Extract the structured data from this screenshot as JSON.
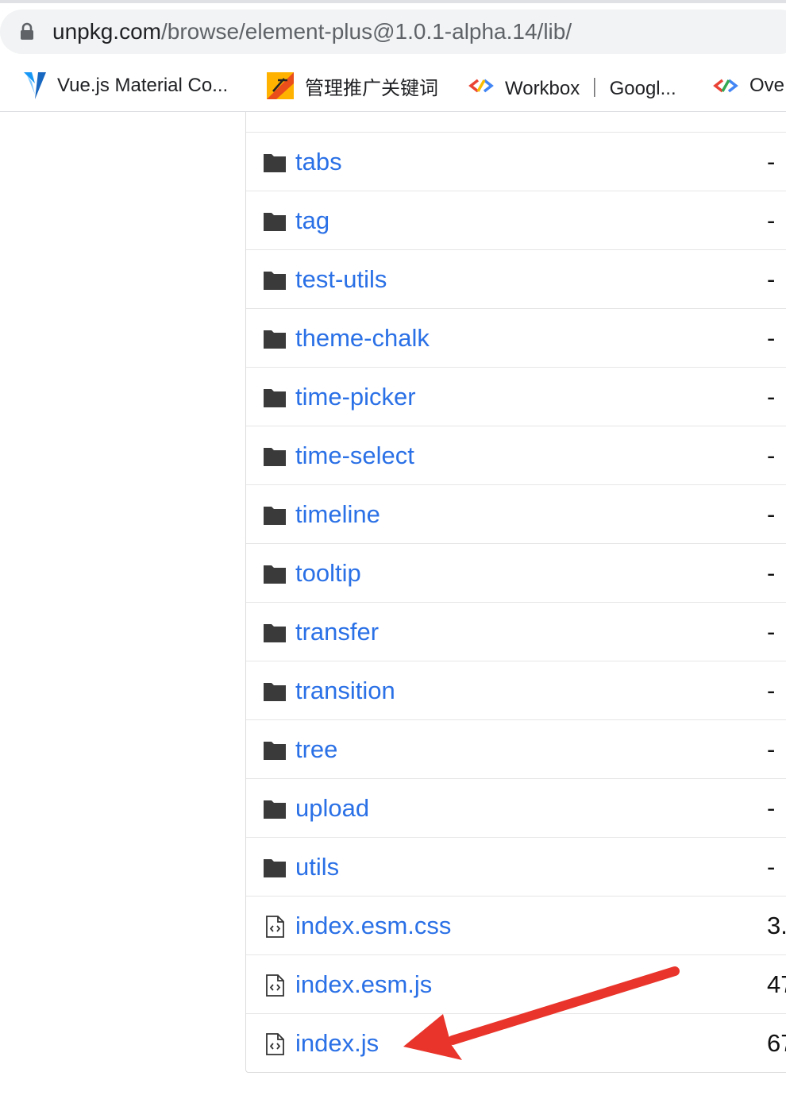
{
  "browser": {
    "url_host": "unpkg.com",
    "url_path": "/browse/element-plus@1.0.1-alpha.14/lib/",
    "bookmarks": [
      {
        "label": "Vue.js Material Co...",
        "icon": "vuetify-icon"
      },
      {
        "label": "管理推广关键词",
        "icon": "tool-logo-icon"
      },
      {
        "label": "Workbox ｜ Googl...",
        "icon": "google-dev-icon"
      },
      {
        "label": "Ove",
        "icon": "google-dev-icon"
      }
    ]
  },
  "listing": {
    "rows": [
      {
        "name": "tabs",
        "type": "folder",
        "size": "-"
      },
      {
        "name": "tag",
        "type": "folder",
        "size": "-"
      },
      {
        "name": "test-utils",
        "type": "folder",
        "size": "-"
      },
      {
        "name": "theme-chalk",
        "type": "folder",
        "size": "-"
      },
      {
        "name": "time-picker",
        "type": "folder",
        "size": "-"
      },
      {
        "name": "time-select",
        "type": "folder",
        "size": "-"
      },
      {
        "name": "timeline",
        "type": "folder",
        "size": "-"
      },
      {
        "name": "tooltip",
        "type": "folder",
        "size": "-"
      },
      {
        "name": "transfer",
        "type": "folder",
        "size": "-"
      },
      {
        "name": "transition",
        "type": "folder",
        "size": "-"
      },
      {
        "name": "tree",
        "type": "folder",
        "size": "-"
      },
      {
        "name": "upload",
        "type": "folder",
        "size": "-"
      },
      {
        "name": "utils",
        "type": "folder",
        "size": "-"
      },
      {
        "name": "index.esm.css",
        "type": "file",
        "size": "3."
      },
      {
        "name": "index.esm.js",
        "type": "file",
        "size": "47"
      },
      {
        "name": "index.js",
        "type": "file",
        "size": "67"
      }
    ]
  },
  "colors": {
    "link": "#2a70e6",
    "annotation_arrow": "#e8342a",
    "folder_icon": "#3a3a3a"
  }
}
